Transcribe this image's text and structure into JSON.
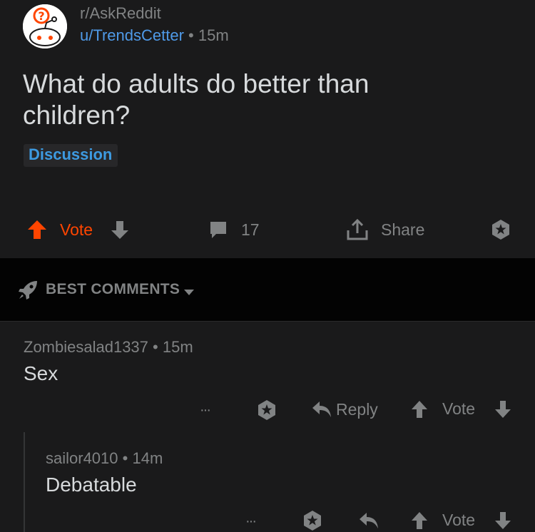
{
  "post": {
    "subreddit": "r/AskReddit",
    "author": "u/TrendsCetter",
    "age": "15m",
    "title": "What do adults do better than children?",
    "flair": "Discussion",
    "vote_label": "Vote",
    "comment_count": "17",
    "share_label": "Share"
  },
  "sort": {
    "label": "BEST COMMENTS"
  },
  "comments": [
    {
      "author": "Zombiesalad1337",
      "age": "15m",
      "body": "Sex",
      "reply_label": "Reply",
      "vote_label": "Vote",
      "more": "···"
    },
    {
      "author": "sailor4010",
      "age": "14m",
      "body": "Debatable",
      "vote_label": "Vote",
      "more": "···"
    }
  ],
  "colors": {
    "background": "#1a1a1b",
    "sort_bar": "#030303",
    "upvote_active": "#ff4500",
    "link_blue": "#4f9ae8",
    "muted_text": "#818384"
  },
  "icons": [
    "askreddit-avatar-icon",
    "upvote-icon",
    "downvote-icon",
    "comment-icon",
    "share-icon",
    "award-icon",
    "rocket-icon",
    "caret-down-icon",
    "reply-icon",
    "more-icon"
  ]
}
